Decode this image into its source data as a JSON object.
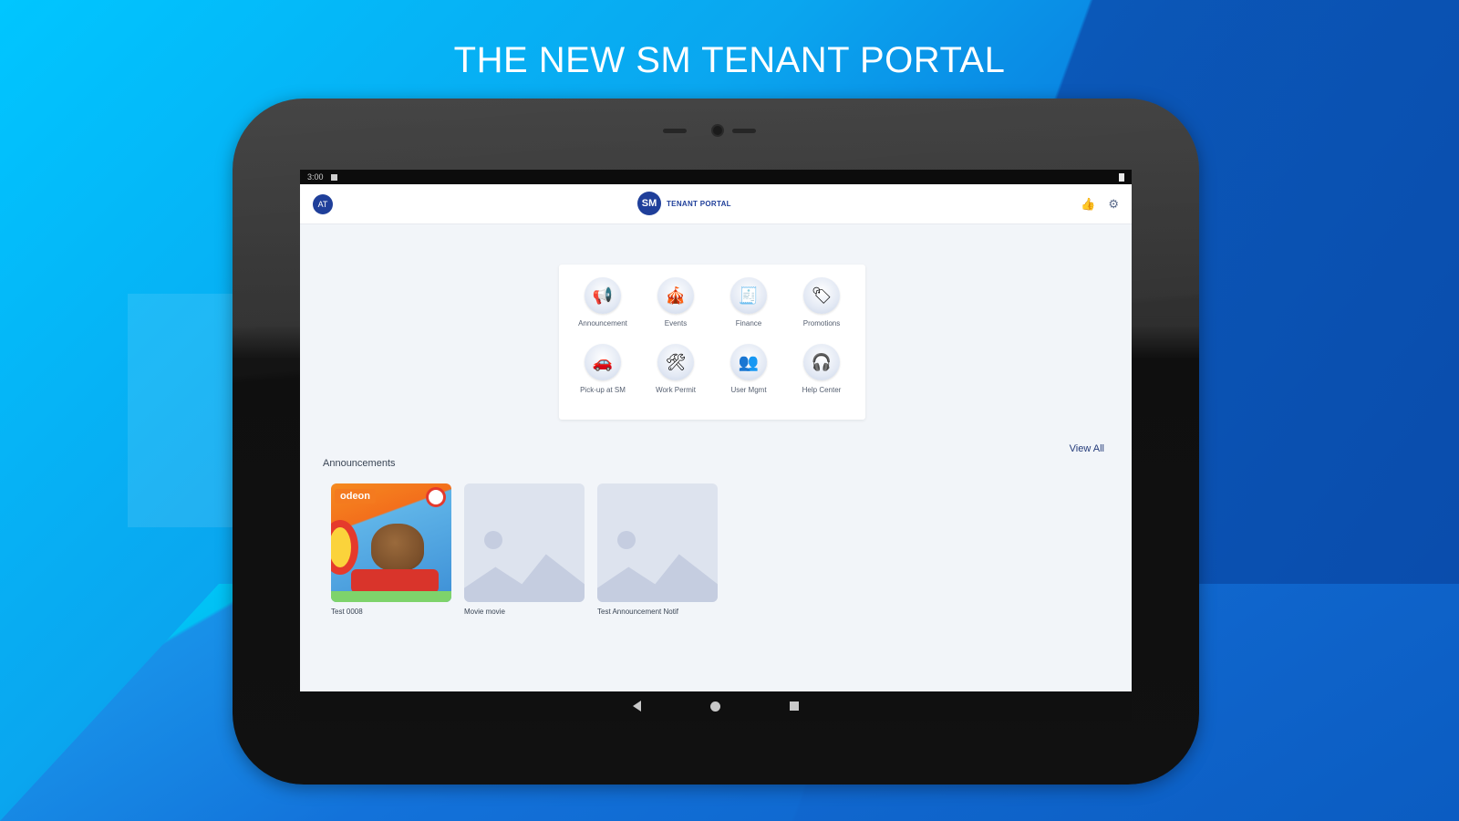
{
  "headline": "THE NEW SM TENANT PORTAL",
  "status_bar": {
    "time": "3:00"
  },
  "app_bar": {
    "avatar_initials": "AT",
    "logo_text": "SM",
    "brand_text": "TENANT PORTAL"
  },
  "menu": [
    {
      "label": "Announcement",
      "icon": "megaphone-icon",
      "glyph": "📢"
    },
    {
      "label": "Events",
      "icon": "events-icon",
      "glyph": "🎪"
    },
    {
      "label": "Finance",
      "icon": "finance-icon",
      "glyph": "🧾"
    },
    {
      "label": "Promotions",
      "icon": "promotions-icon",
      "glyph": "🏷"
    },
    {
      "label": "Pick-up at SM",
      "icon": "pickup-car-icon",
      "glyph": "🚗"
    },
    {
      "label": "Work Permit",
      "icon": "work-permit-icon",
      "glyph": "🛠"
    },
    {
      "label": "User Mgmt",
      "icon": "user-management-icon",
      "glyph": "👥"
    },
    {
      "label": "Help Center",
      "icon": "help-center-icon",
      "glyph": "🎧"
    }
  ],
  "announcements": {
    "title": "Announcements",
    "view_all": "View All",
    "items": [
      {
        "caption": "Test 0008",
        "thumb": "photo",
        "tag": "odeon"
      },
      {
        "caption": "Movie movie",
        "thumb": "placeholder"
      },
      {
        "caption": "Test Announcement Notif",
        "thumb": "placeholder"
      }
    ]
  },
  "colors": {
    "brand": "#1f3f9a",
    "background": "#0a7fe0",
    "screen": "#f2f5f9"
  }
}
